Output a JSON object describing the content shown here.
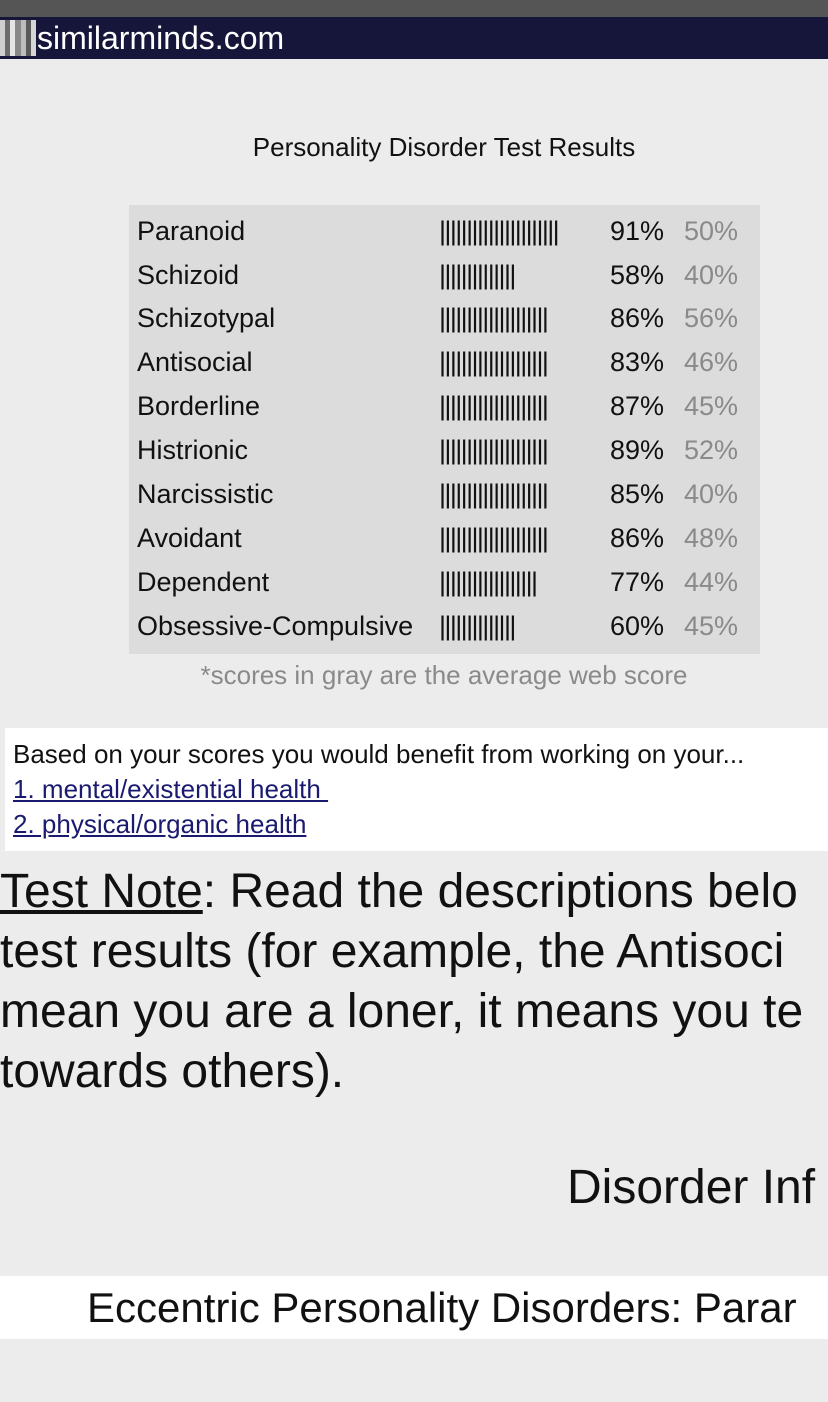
{
  "header": {
    "site_name": "similarminds.com"
  },
  "results": {
    "title": "Personality Disorder Test Results",
    "rows": [
      {
        "name": "Paranoid",
        "bars": "||||||||||||||||||||||",
        "score": "91%",
        "avg": "50%"
      },
      {
        "name": "Schizoid",
        "bars": "||||||||||||||",
        "score": "58%",
        "avg": "40%"
      },
      {
        "name": "Schizotypal",
        "bars": "||||||||||||||||||||",
        "score": "86%",
        "avg": "56%"
      },
      {
        "name": "Antisocial",
        "bars": "||||||||||||||||||||",
        "score": "83%",
        "avg": "46%"
      },
      {
        "name": "Borderline",
        "bars": "||||||||||||||||||||",
        "score": "87%",
        "avg": "45%"
      },
      {
        "name": "Histrionic",
        "bars": "||||||||||||||||||||",
        "score": "89%",
        "avg": "52%"
      },
      {
        "name": "Narcissistic",
        "bars": "||||||||||||||||||||",
        "score": "85%",
        "avg": "40%"
      },
      {
        "name": "Avoidant",
        "bars": "||||||||||||||||||||",
        "score": "86%",
        "avg": "48%"
      },
      {
        "name": "Dependent",
        "bars": "||||||||||||||||||",
        "score": "77%",
        "avg": "44%"
      },
      {
        "name": "Obsessive-Compulsive",
        "bars": "||||||||||||||",
        "score": "60%",
        "avg": "45%"
      }
    ],
    "footnote": "*scores in gray are the average web score"
  },
  "advice": {
    "intro": "Based on your scores you would benefit from working on your...",
    "links": [
      "1. mental/existential health ",
      "2. physical/organic health"
    ]
  },
  "test_note": {
    "label": "Test Note",
    "lines": [
      ": Read the descriptions belo",
      "test results (for example, the Antisoci",
      "mean you are a loner, it means you te",
      "towards others)."
    ]
  },
  "sections": {
    "disorder_info": "Disorder Inf",
    "eccentric": "Eccentric Personality Disorders: Parar"
  },
  "colors": {
    "header_bg": "#16163a",
    "table_bg": "#dcdcdc",
    "avg_gray": "#8a8a8a",
    "link": "#1a1a70"
  }
}
